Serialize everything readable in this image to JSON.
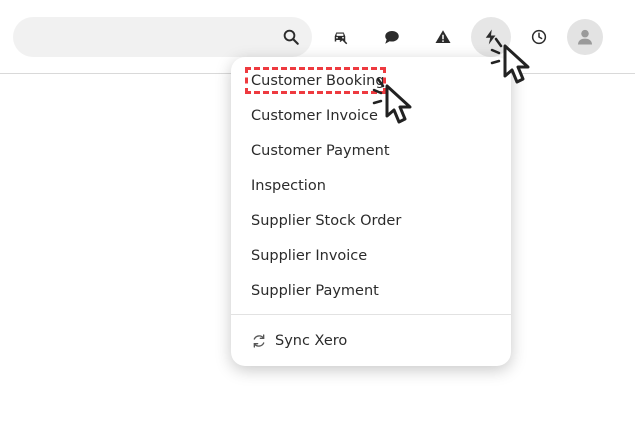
{
  "search": {
    "placeholder": ""
  },
  "toolbar": {
    "icons": [
      "search-icon",
      "car-icon",
      "chat-icon",
      "warning-icon",
      "lightning-icon",
      "clock-icon",
      "user-icon"
    ]
  },
  "menu": {
    "items": [
      "Customer Booking",
      "Customer Invoice",
      "Customer Payment",
      "Inspection",
      "Supplier Stock Order",
      "Supplier Invoice",
      "Supplier Payment"
    ],
    "sync_label": "Sync Xero"
  },
  "colors": {
    "highlight": "#ee3a3f",
    "icon": "#2b2b2b",
    "active_bg": "#e6e6e6"
  }
}
